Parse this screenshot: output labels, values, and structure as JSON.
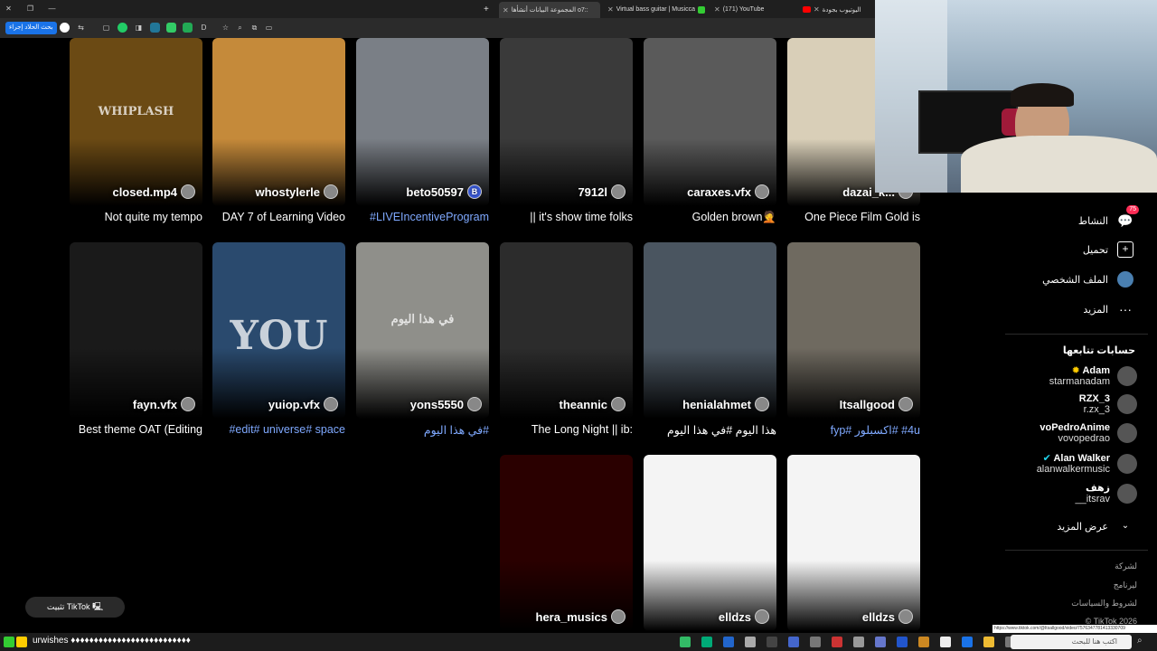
{
  "browser": {
    "tabs": [
      {
        "label": "المجموعة البيانات أنشأها o7::",
        "active": true
      },
      {
        "label": "Virtual bass guitar | Musicca",
        "active": false
      },
      {
        "label": "(171) YouTube",
        "active": false
      },
      {
        "label": "اليوتيوب بجودة",
        "active": false
      }
    ],
    "toolbar_chip": "بحث الحلاد إجراء",
    "new_tab": "+"
  },
  "videos": [
    {
      "user": "closed.mp4",
      "caption": "Not quite my tempo",
      "caption_style": "ltr",
      "thumb_color": "#6b4a14",
      "thumb_text": "WHIPLASH"
    },
    {
      "user": "whostylerle",
      "caption": "DAY 7 of Learning Video",
      "caption_style": "ltr",
      "thumb_color": "#c58a3a"
    },
    {
      "user": "beto50597",
      "caption": "LIVEIncentiveProgram#",
      "caption_style": "blue",
      "thumb_color": "#7a7f86",
      "badge": "B"
    },
    {
      "user": "7912l",
      "caption": "|| it's show time folks",
      "caption_style": "ltr",
      "thumb_color": "#3a3a3a"
    },
    {
      "user": "caraxes.vfx",
      "caption": "Golden brown🤦",
      "caption_style": "ltr",
      "thumb_color": "#5a5a5a"
    },
    {
      "user": "dazai_k...",
      "caption": "One Piece Film Gold is",
      "caption_style": "ltr",
      "thumb_color": "#d9cfb8"
    },
    {
      "user": "fayn.vfx",
      "caption": "Best theme OAT (Editing",
      "caption_style": "ltr",
      "thumb_color": "#1a1a1a"
    },
    {
      "user": "yuiop.vfx",
      "caption": "edit# universe# space#",
      "caption_style": "blue",
      "thumb_color": "#2a4a6e",
      "thumb_text": "YOU"
    },
    {
      "user": "yons5550",
      "caption": "#في هذا اليوم",
      "caption_style": "blue",
      "thumb_color": "#8f8f8a",
      "thumb_text": "في هذا اليوم"
    },
    {
      "user": "theannic",
      "caption": "The Long Night || ib:",
      "caption_style": "ltr",
      "thumb_color": "#2c2c2c"
    },
    {
      "user": "henialahmet",
      "caption": "هذا اليوم #في هذا اليوم",
      "caption_style": "rtl",
      "thumb_color": "#4a5560"
    },
    {
      "user": "Itsallgood",
      "caption": "#4u #اكسبلور #fyp",
      "caption_style": "blue",
      "thumb_color": "#6f6a60"
    },
    {
      "user": "hera_musics",
      "caption": "",
      "caption_style": "ltr",
      "thumb_color": "#2a0000"
    },
    {
      "user": "elldzs",
      "caption": "",
      "caption_style": "ltr",
      "thumb_color": "#f4f4f4"
    },
    {
      "user": "elldzs",
      "caption": "",
      "caption_style": "ltr",
      "thumb_color": "#f4f4f4"
    }
  ],
  "sidebar": {
    "nav": [
      {
        "label": "النشاط",
        "icon": "activity-icon",
        "badge": "75"
      },
      {
        "label": "تحميل",
        "icon": "upload-icon"
      },
      {
        "label": "الملف الشخصي",
        "icon": "profile-icon"
      },
      {
        "label": "المزيد",
        "icon": "more-icon"
      }
    ],
    "following_title": "حسابات تتابعها",
    "accounts": [
      {
        "name": "Adam",
        "handle": "starmanadam",
        "star": true
      },
      {
        "name": "RZX_3",
        "handle": "r.zx_3"
      },
      {
        "name": "voPedroAnime",
        "handle": "vovopedrao"
      },
      {
        "name": "Alan Walker",
        "handle": "alanwalkermusic",
        "verified": true
      },
      {
        "name": "زهف",
        "handle": "__itsrav"
      }
    ],
    "see_more": "عرض المزيد",
    "footer": [
      "لشركة",
      "ليرنامج",
      "لشروط والسياسات",
      "TikTok 2026 ©"
    ]
  },
  "install_button": "تثبيت TikTok",
  "status_url": "https://www.tiktok.com/@Itsallgood/video/7576347781413330709",
  "taskbar": {
    "chat_line": "urwishes ♦♦♦♦♦♦♦♦♦♦♦♦♦♦♦♦♦♦♦♦♦♦♦♦♦♦",
    "search_placeholder": "اكتب هنا للبحث"
  }
}
